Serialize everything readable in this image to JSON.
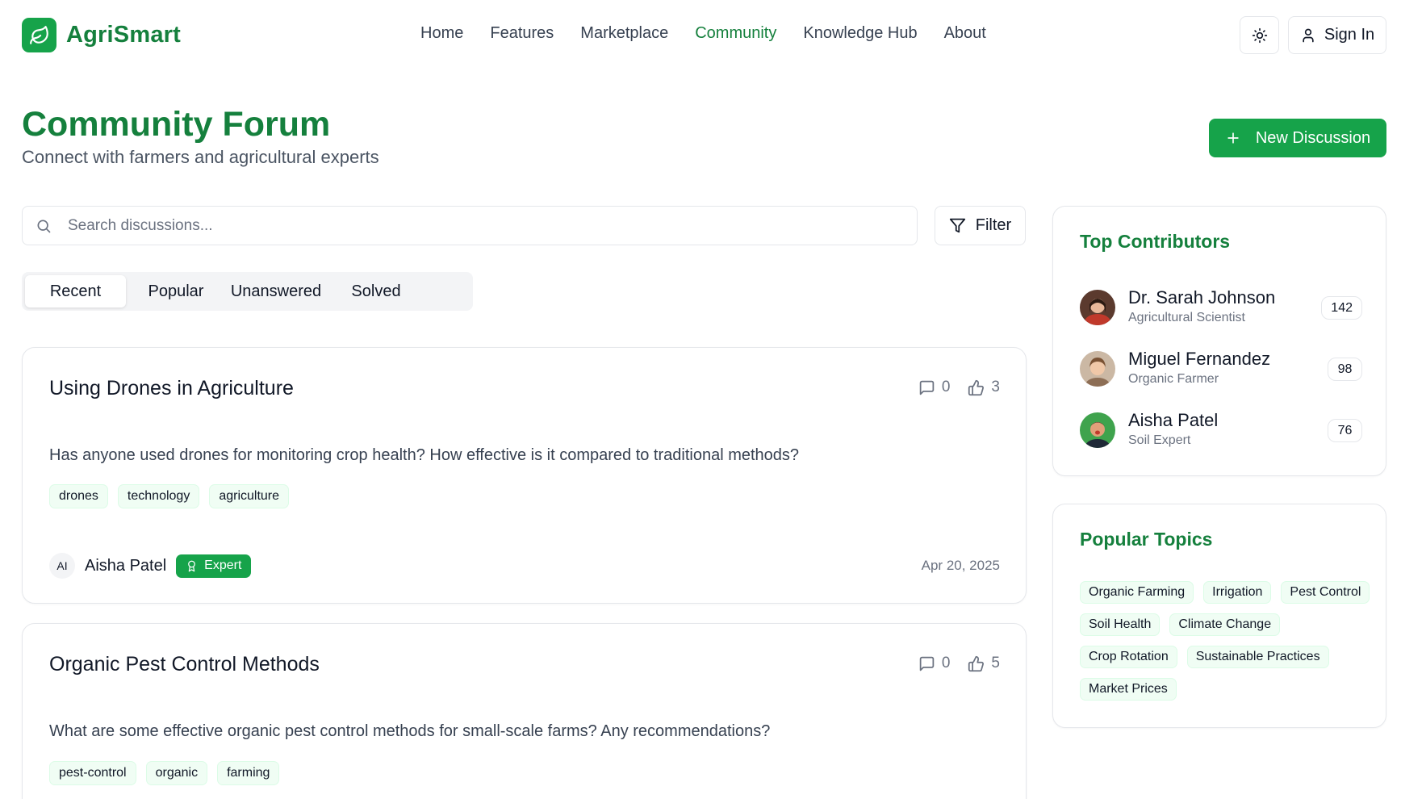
{
  "app": {
    "name": "AgriSmart",
    "logo_icon": "leaf-icon",
    "accent": "#16a34a",
    "accent_dark": "#15803d"
  },
  "nav": {
    "items": [
      {
        "label": "Home"
      },
      {
        "label": "Features"
      },
      {
        "label": "Marketplace"
      },
      {
        "label": "Community",
        "active": true
      },
      {
        "label": "Knowledge Hub"
      },
      {
        "label": "About"
      }
    ],
    "theme_icon": "sun-icon",
    "signin_label": "Sign In"
  },
  "page": {
    "title": "Community Forum",
    "subtitle": "Connect with farmers and agricultural experts",
    "new_button_label": "New Discussion"
  },
  "search": {
    "placeholder": "Search discussions...",
    "value": ""
  },
  "filter_label": "Filter",
  "tabs": [
    {
      "label": "Recent",
      "active": true
    },
    {
      "label": "Popular"
    },
    {
      "label": "Unanswered"
    },
    {
      "label": "Solved"
    }
  ],
  "posts": [
    {
      "title": "Using Drones in Agriculture",
      "comments": "0",
      "likes": "3",
      "body": "Has anyone used drones for monitoring crop health? How effective is it compared to traditional methods?",
      "tags": [
        "drones",
        "technology",
        "agriculture"
      ],
      "author_initials": "AI",
      "author": "Aisha Patel",
      "badge": "Expert",
      "date": "Apr 20, 2025"
    },
    {
      "title": "Organic Pest Control Methods",
      "comments": "0",
      "likes": "5",
      "body": "What are some effective organic pest control methods for small-scale farms? Any recommendations?",
      "tags": [
        "pest-control",
        "organic",
        "farming"
      ]
    }
  ],
  "sidebar": {
    "contributors_title": "Top Contributors",
    "contributors": [
      {
        "name": "Dr. Sarah Johnson",
        "role": "Agricultural Scientist",
        "count": "142"
      },
      {
        "name": "Miguel Fernandez",
        "role": "Organic Farmer",
        "count": "98"
      },
      {
        "name": "Aisha Patel",
        "role": "Soil Expert",
        "count": "76"
      }
    ],
    "topics_title": "Popular Topics",
    "topics": [
      "Organic Farming",
      "Irrigation",
      "Pest Control",
      "Soil Health",
      "Climate Change",
      "Crop Rotation",
      "Sustainable Practices",
      "Market Prices"
    ]
  }
}
